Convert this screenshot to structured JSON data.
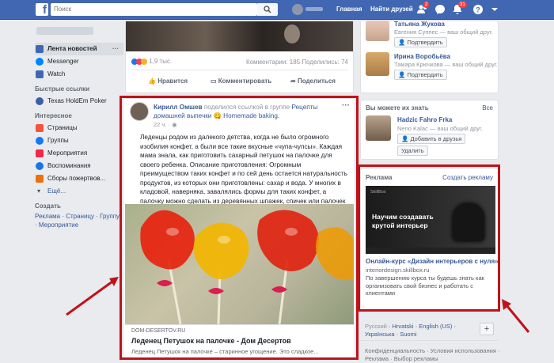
{
  "topbar": {
    "logo": "f",
    "search_placeholder": "Поиск",
    "home": "Главная",
    "find_friends": "Найти друзей",
    "badge_friends": "2",
    "badge_notifications": "31"
  },
  "sidebar": {
    "news_feed": "Лента новостей",
    "messenger": "Messenger",
    "watch": "Watch",
    "shortcuts_head": "Быстрые ссылки",
    "poker": "Texas HoldEm Poker",
    "interesting_head": "Интересное",
    "pages": "Страницы",
    "groups": "Группы",
    "events": "Мероприятия",
    "memories": "Воспоминания",
    "fundraisers": "Сборы пожертвов...",
    "more": "Ещё...",
    "create_head": "Создать",
    "create_links": "Реклама · Страницу · Группу · Мероприятие"
  },
  "prev_post": {
    "reactions": "1,9 тыс.",
    "stats": "Комментарии: 185 Поделились: 74",
    "like": "Нравится",
    "comment": "Комментировать",
    "share": "Поделиться"
  },
  "post": {
    "author": "Кирилл Омшев",
    "shared": "поделился ссылкой в группе",
    "group": "Рецепты домашней выпечки",
    "emoji": "😋",
    "group_tail": "Homemade baking.",
    "time": "22 ч.",
    "dot": "·",
    "text": "Леденцы родом из далекого детства, когда не было огромного изобилия конфет, а были все такие вкусные «чупа-чупсы». Каждая мама знала, как приготовить сахарный петушок на палочке для своего ребенка. Описание приготовления: Огромным преимуществом таких конфет и по сей день остается натуральность продуктов, из которых они приготовлены: сахар и вода. У многих в кладовой, наверняка, завалялись формы для таких конфет, а палочку можно сделать из деревянных шпажек, спичек или палочек из-под мороженого.",
    "domain": "DOM-DESERTOV.RU",
    "link_title": "Леденец Петушок на палочке - Дом Десертов",
    "link_desc": "Леденец Петушок на палочке – старинное угощение. Это сладкое..."
  },
  "requests": [
    {
      "name": "Татьяна Жукова",
      "mutual": "Евгения Суппес — ваш общий друг.",
      "confirm": "Подтвердить"
    },
    {
      "name": "Ирина Воробьёва",
      "mutual": "Тамара Крючкова — ваш общий друг.",
      "confirm": "Подтвердить"
    }
  ],
  "pymk": {
    "title": "Вы можете их знать",
    "all": "Все",
    "name": "Hadzic Fahro Frka",
    "mutual": "Neno Kalac — ваш общий друг.",
    "add": "Добавить в друзья",
    "remove": "Удалить"
  },
  "ad": {
    "title": "Реклама",
    "create": "Создать рекламу",
    "banner_brand": "SkillBox",
    "banner_text": "Научим создавать крутой интерьер",
    "headline": "Онлайн-курс «Дизайн интерьеров с нуля»",
    "url": "interiordesign.skillbox.ru",
    "desc": "По завершению курса ты будешь знать как организовать свой бизнес и работать с клиентами"
  },
  "langs": {
    "current": "Русский",
    "l1": "Hrvatski",
    "l2": "English (US)",
    "l3": "Українська",
    "l4": "Suomi",
    "add": "+"
  },
  "footer": "Конфиденциальность · Условия использования · Реклама · Выбор рекламы",
  "colors": {
    "brand": "#4267b2",
    "highlight": "#c0121a"
  }
}
